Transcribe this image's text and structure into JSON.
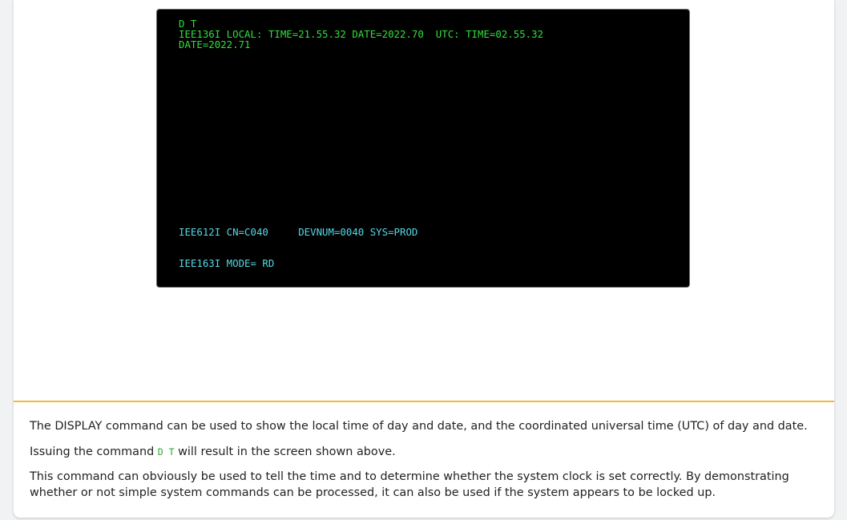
{
  "terminal": {
    "lines": [
      "D T",
      "IEE136I LOCAL: TIME=21.55.32 DATE=2022.70  UTC: TIME=02.55.32",
      "DATE=2022.71",
      "IEE612I CN=C040     DEVNUM=0040 SYS=PROD",
      "IEE163I MODE= RD"
    ],
    "colors": {
      "command_output": "#2fe03a",
      "status": "#56d9e8",
      "background": "#000000"
    }
  },
  "description": {
    "para1": "The DISPLAY command can be used to show the local time of day and date, and the coordinated universal time (UTC) of day and date.",
    "para2_before": "Issuing the command ",
    "para2_code": "D T",
    "para2_after": " will result in the screen shown above.",
    "para3": "This command can obviously be used to tell the time and to determine whether the system clock is set correctly. By demonstrating whether or not simple system commands can be processed, it can also be used if the system appears to be locked up."
  },
  "accent_color": "#f1b93a"
}
